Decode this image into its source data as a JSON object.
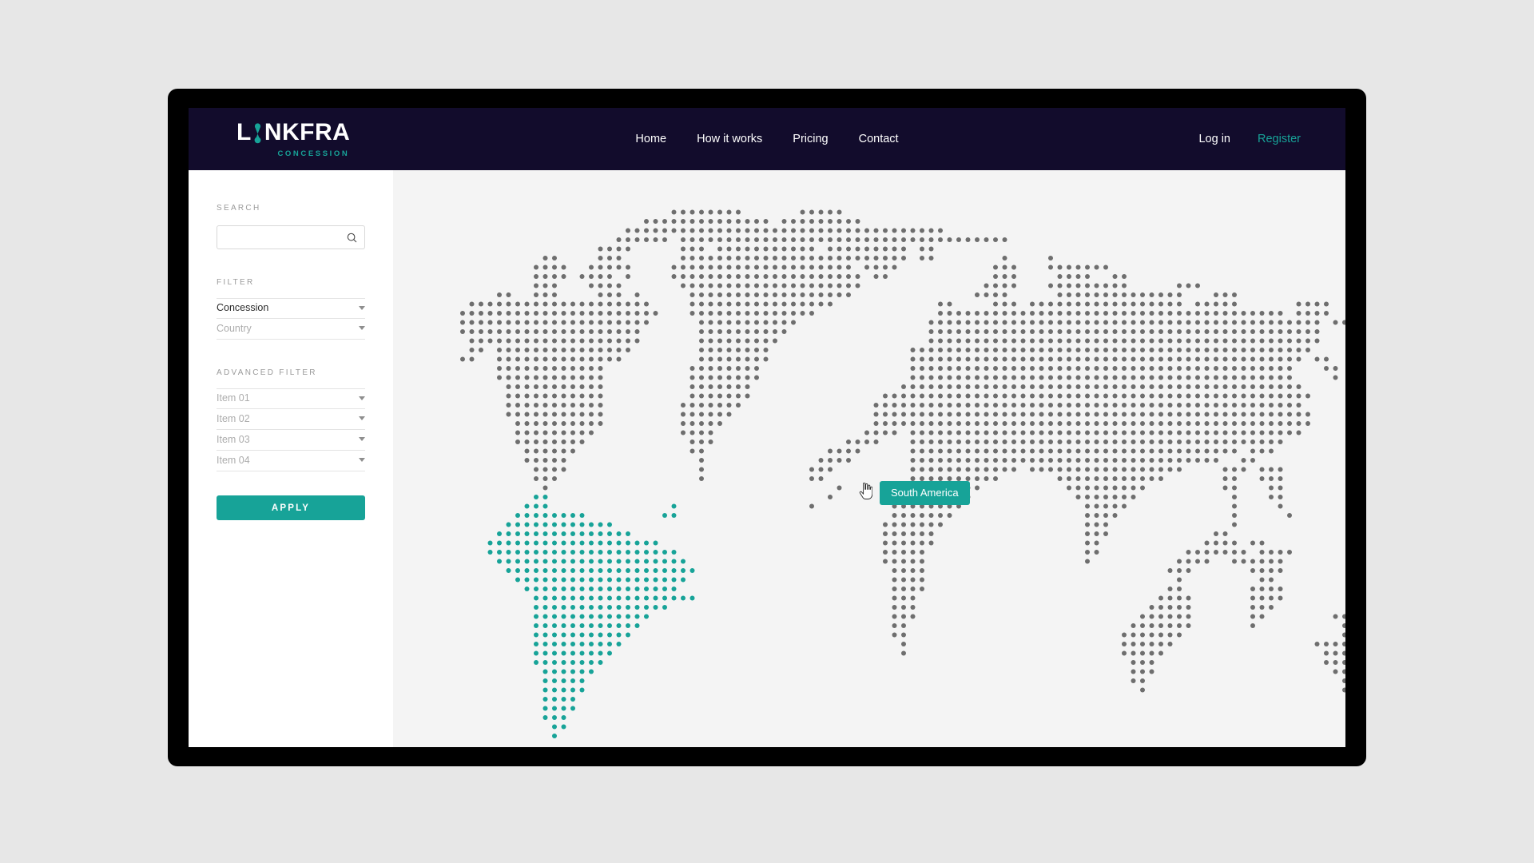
{
  "brand": {
    "name_left": "L",
    "name_right": "NKFRA",
    "mark_icon": "hourglass-node-icon",
    "subtitle": "CONCESSION",
    "accent_color": "#17a398",
    "header_color": "#120c2c"
  },
  "nav": {
    "items": [
      {
        "label": "Home"
      },
      {
        "label": "How it works"
      },
      {
        "label": "Pricing"
      },
      {
        "label": "Contact"
      }
    ],
    "login_label": "Log in",
    "register_label": "Register"
  },
  "sidebar": {
    "search": {
      "label": "SEARCH",
      "value": "",
      "placeholder": "",
      "icon": "search-icon"
    },
    "filter": {
      "label": "FILTER",
      "fields": [
        {
          "value": "Concession",
          "selected": true
        },
        {
          "value": "Country",
          "selected": false
        }
      ]
    },
    "advanced_filter": {
      "label": "ADVANCED FILTER",
      "fields": [
        {
          "value": "Item 01",
          "selected": false
        },
        {
          "value": "Item 02",
          "selected": false
        },
        {
          "value": "Item 03",
          "selected": false
        },
        {
          "value": "Item 04",
          "selected": false
        }
      ]
    },
    "apply_label": "APPLY"
  },
  "map": {
    "tooltip_label": "South America",
    "tooltip_color": "#17a398",
    "dot_color": "#6e6e6e",
    "highlight_color": "#17a398",
    "background_color": "#f4f4f4",
    "cursor_icon": "pointing-hand-cursor"
  }
}
